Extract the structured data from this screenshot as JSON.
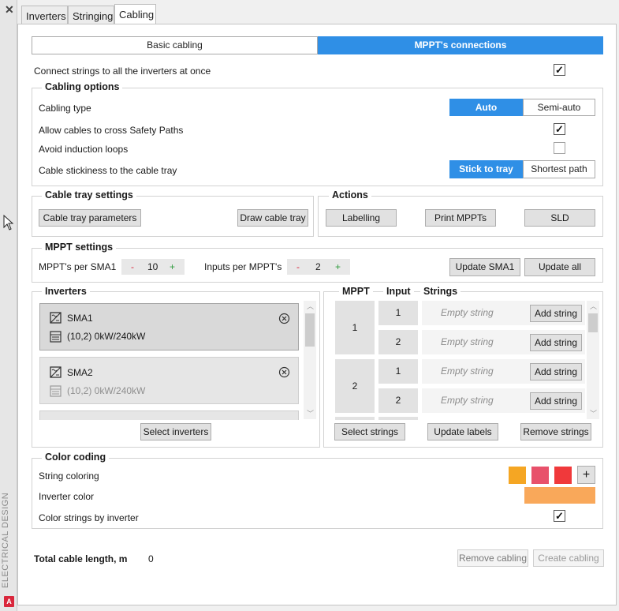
{
  "rail": {
    "close_glyph": "✕",
    "vertical_label": "ELECTRICAL DESIGN",
    "logo_letter": "A"
  },
  "tabs": [
    "Inverters",
    "Stringing",
    "Cabling"
  ],
  "mode_toggle": {
    "left": "Basic cabling",
    "right": "MPPT's connections",
    "selected": "MPPT's connections"
  },
  "connect_all": {
    "label": "Connect strings to all the inverters at once",
    "checked": true
  },
  "cabling_options": {
    "title": "Cabling options",
    "type_label": "Cabling type",
    "type_options": [
      "Auto",
      "Semi-auto"
    ],
    "type_selected": "Auto",
    "cross_label": "Allow cables to cross Safety Paths",
    "cross_checked": true,
    "loops_label": "Avoid induction loops",
    "loops_checked": false,
    "stick_label": "Cable stickiness to the cable tray",
    "stick_options": [
      "Stick to tray",
      "Shortest path"
    ],
    "stick_selected": "Stick to tray"
  },
  "tray": {
    "title": "Cable tray settings",
    "params_button": "Cable tray parameters",
    "draw_button": "Draw cable tray"
  },
  "actions": {
    "title": "Actions",
    "buttons": [
      "Labelling",
      "Print MPPTs",
      "SLD"
    ]
  },
  "mppt_settings": {
    "title": "MPPT settings",
    "per_label": "MPPT's per SMA1",
    "per_value": "10",
    "inputs_label": "Inputs per MPPT's",
    "inputs_value": "2",
    "minus": "-",
    "plus": "+",
    "update_one": "Update SMA1",
    "update_all": "Update all"
  },
  "inverters": {
    "title": "Inverters",
    "items": [
      {
        "name": "SMA1",
        "info": "(10,2)  0kW/240kW",
        "selected": true
      },
      {
        "name": "SMA2",
        "info": "(10,2)  0kW/240kW",
        "selected": false
      }
    ],
    "select_button": "Select inverters"
  },
  "mppt_table": {
    "headers": [
      "MPPT",
      "Input",
      "Strings"
    ],
    "groups": [
      {
        "mppt": "1",
        "inputs": [
          {
            "input": "1",
            "string": "Empty string",
            "add": "Add string"
          },
          {
            "input": "2",
            "string": "Empty string",
            "add": "Add string"
          }
        ]
      },
      {
        "mppt": "2",
        "inputs": [
          {
            "input": "1",
            "string": "Empty string",
            "add": "Add string"
          },
          {
            "input": "2",
            "string": "Empty string",
            "add": "Add string"
          }
        ]
      }
    ],
    "buttons": [
      "Select strings",
      "Update labels",
      "Remove strings"
    ]
  },
  "color_coding": {
    "title": "Color coding",
    "string_label": "String coloring",
    "string_colors": [
      "#f5a623",
      "#e8516b",
      "#f0393b"
    ],
    "add_glyph": "+",
    "inverter_label": "Inverter color",
    "inverter_color": "#f9a85a",
    "by_inverter_label": "Color strings by inverter",
    "by_inverter_checked": true
  },
  "footer": {
    "length_label": "Total cable length, m",
    "length_value": "0",
    "remove_button": "Remove cabling",
    "create_button": "Create cabling"
  },
  "colors": {
    "accent": "#2f8fe6",
    "minus": "#d9273c",
    "plus": "#2e9b3c"
  }
}
